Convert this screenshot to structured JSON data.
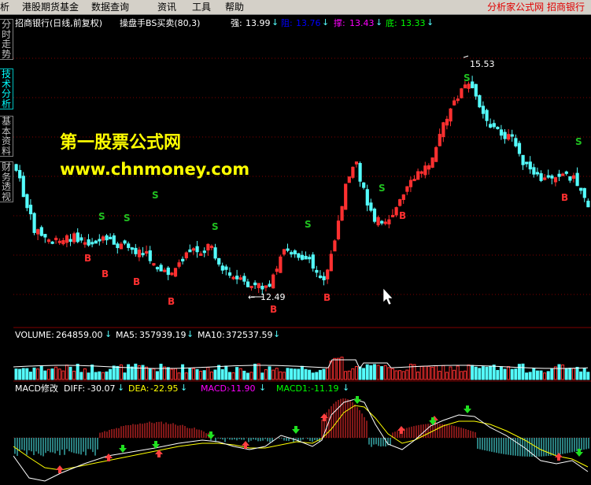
{
  "menu": {
    "items": [
      "析",
      "港股期货基金",
      "数据查询",
      "资讯",
      "工具",
      "帮助"
    ],
    "right_text": "分析家公式网  招商银行"
  },
  "sidebar": {
    "tabs": [
      {
        "label": "分时走势",
        "active": false
      },
      {
        "label": "技术分析",
        "active": true
      },
      {
        "label": "基本资料",
        "active": false
      },
      {
        "label": "财务透视",
        "active": false
      }
    ]
  },
  "main_chart": {
    "title": "招商银行(日线,前复权)",
    "indicator": "操盘手BS买卖(80,3)",
    "qiang_label": "强:",
    "qiang_value": "13.99",
    "zu_label": "阻:",
    "zu_value": "13.76",
    "cheng_label": "撑:",
    "cheng_value": "13.43",
    "di_label": "底:",
    "di_value": "13.33",
    "high_marker": "15.53",
    "low_marker": "12.49",
    "buy_label": "B",
    "sell_label": "S"
  },
  "volume_panel": {
    "volume_label": "VOLUME:",
    "volume_value": "264859.00",
    "ma5_label": "MA5:",
    "ma5_value": "357939.19",
    "ma10_label": "MA10:",
    "ma10_value": "372537.59"
  },
  "macd_panel": {
    "title": "MACD修改",
    "diff_label": "DIFF:",
    "diff_value": "-30.07",
    "dea_label": "DEA:",
    "dea_value": "-22.95",
    "macd_label": "MACD:",
    "macd_value": "-11.90",
    "macd1_label": "MACD1:",
    "macd1_value": "-11.19"
  },
  "watermark": {
    "line1": "第一股票公式网",
    "line2": "www.chnmoney.com"
  },
  "colors": {
    "up": "#ff3030",
    "down": "#54fcfc",
    "buy": "#ff3030",
    "sell": "#20c020",
    "grid": "#800000",
    "diff": "#ffffff",
    "dea": "#ffff00",
    "macd_label": "#ff00ff",
    "macd1_label": "#00ff00"
  }
}
